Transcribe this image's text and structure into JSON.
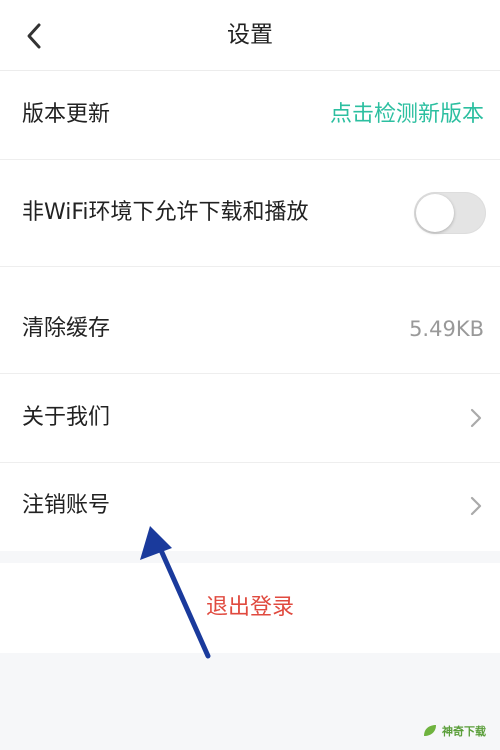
{
  "header": {
    "title": "设置"
  },
  "settings": {
    "rows": [
      {
        "label": "版本更新",
        "value": "点击检测新版本"
      },
      {
        "label": "非WiFi环境下允许下载和播放",
        "toggle_on": false
      },
      {
        "label": "清除缓存",
        "value": "5.49KB"
      },
      {
        "label": "关于我们"
      },
      {
        "label": "注销账号"
      }
    ]
  },
  "logout": {
    "label": "退出登录"
  },
  "annotation": {
    "arrow_color": "#1a3a9c"
  },
  "watermark": {
    "text": "神奇下载"
  },
  "colors": {
    "accent": "#2cbfa0",
    "danger": "#e04a3f"
  }
}
